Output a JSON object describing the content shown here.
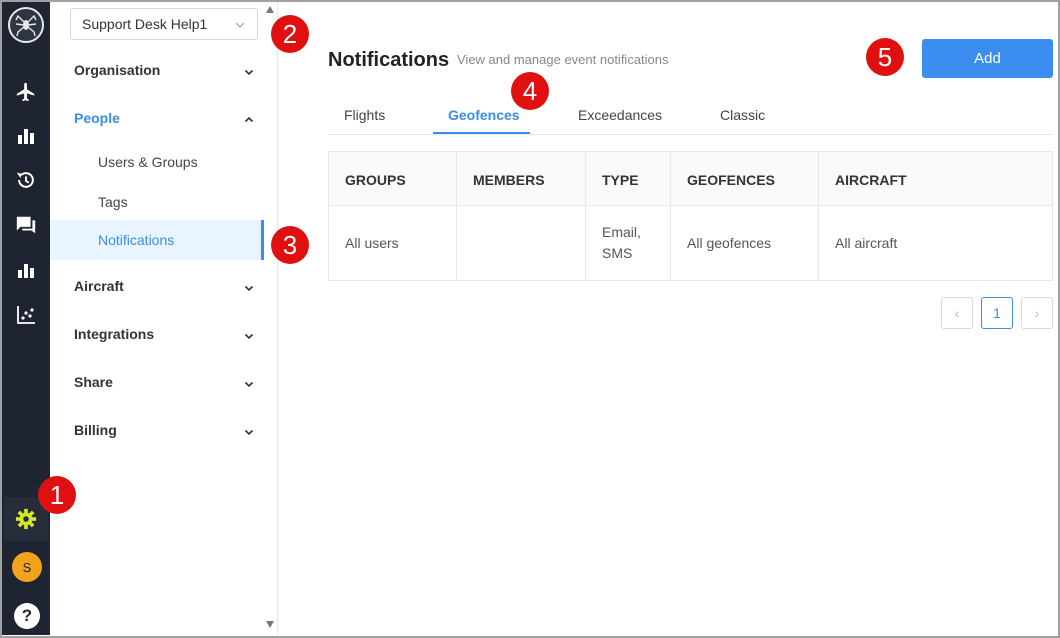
{
  "org_select": {
    "value": "Support Desk Help1"
  },
  "nav": {
    "items": [
      {
        "label": "Organisation"
      },
      {
        "label": "People"
      },
      {
        "label": "Aircraft"
      },
      {
        "label": "Integrations"
      },
      {
        "label": "Share"
      },
      {
        "label": "Billing"
      }
    ],
    "people_sub": [
      {
        "label": "Users & Groups"
      },
      {
        "label": "Tags"
      },
      {
        "label": "Notifications"
      }
    ]
  },
  "rail": {
    "icons": [
      "spider-logo-icon",
      "airplane-icon",
      "bar-chart-icon",
      "history-icon",
      "chat-icon",
      "stats-icon",
      "scatter-chart-icon",
      "gear-icon"
    ],
    "avatar_initial": "S",
    "help_label": "?"
  },
  "header": {
    "title": "Notifications",
    "subtitle": "View and manage event notifications",
    "add_label": "Add"
  },
  "tabs": [
    {
      "label": "Flights"
    },
    {
      "label": "Geofences"
    },
    {
      "label": "Exceedances"
    },
    {
      "label": "Classic"
    }
  ],
  "table": {
    "headers": [
      "GROUPS",
      "MEMBERS",
      "TYPE",
      "GEOFENCES",
      "AIRCRAFT"
    ],
    "rows": [
      {
        "groups": "All users",
        "members": "",
        "type": "Email,\nSMS",
        "geofences": "All geofences",
        "aircraft": "All aircraft"
      }
    ]
  },
  "pagination": {
    "current": "1",
    "prev_glyph": "‹",
    "next_glyph": "›"
  },
  "callouts": [
    "1",
    "2",
    "3",
    "4",
    "5"
  ],
  "colors": {
    "accent": "#3a8ee6",
    "rail_bg": "#1e2431",
    "callout": "#e01010",
    "gear_active": "#d4e62a"
  }
}
